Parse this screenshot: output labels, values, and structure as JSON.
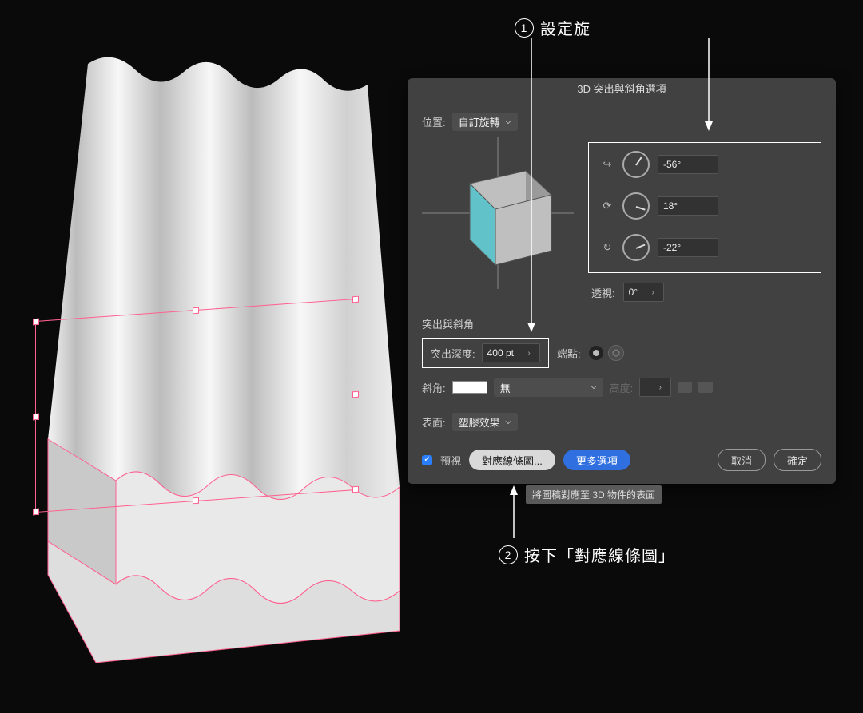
{
  "annotations": {
    "step1": {
      "num": "1",
      "text": "設定旋"
    },
    "step2": {
      "num": "2",
      "text": "按下「對應線條圖」"
    }
  },
  "dialog": {
    "title": "3D 突出與斜角選項",
    "position_label": "位置:",
    "position_value": "自訂旋轉",
    "rotation": {
      "x": "-56°",
      "y": "18°",
      "z": "-22°"
    },
    "perspective_label": "透視:",
    "perspective_value": "0°",
    "section_extrude": "突出與斜角",
    "depth_label": "突出深度:",
    "depth_value": "400 pt",
    "cap_label": "端點:",
    "bevel_label": "斜角:",
    "bevel_value": "無",
    "height_label": "高度:",
    "height_value": "",
    "surface_label": "表面:",
    "surface_value": "塑膠效果",
    "preview_label": "預視",
    "btn_map": "對應線條圖...",
    "btn_more": "更多選項",
    "btn_cancel": "取消",
    "btn_ok": "確定",
    "tooltip": "將圖稿對應至 3D 物件的表面"
  }
}
